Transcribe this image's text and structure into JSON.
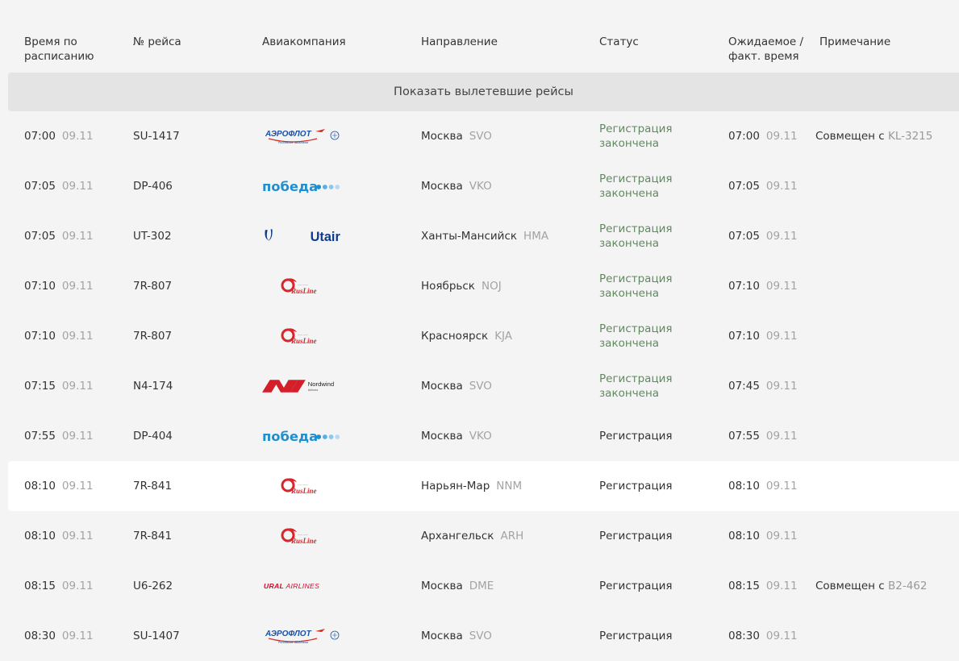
{
  "headers": {
    "time": [
      "Время по",
      "расписанию"
    ],
    "flight": "№ рейса",
    "airline": "Авиакомпания",
    "destination": "Направление",
    "status": "Статус",
    "expected": [
      "Ожидаемое /",
      "факт. время"
    ],
    "note": "Примечание"
  },
  "show_departed": "Показать вылетевшие рейсы",
  "rows": [
    {
      "time": "07:00",
      "date": "09.11",
      "flight": "SU-1417",
      "airline_logo": "aeroflot-logo",
      "city": "Москва",
      "code": "SVO",
      "status": [
        "Регистрация",
        "закончена"
      ],
      "status_done": true,
      "exp_time": "07:00",
      "exp_date": "09.11",
      "note_prefix": "Совмещен с ",
      "note_code": "KL-3215"
    },
    {
      "time": "07:05",
      "date": "09.11",
      "flight": "DP-406",
      "airline_logo": "pobeda-logo",
      "city": "Москва",
      "code": "VKO",
      "status": [
        "Регистрация",
        "закончена"
      ],
      "status_done": true,
      "exp_time": "07:05",
      "exp_date": "09.11",
      "note_prefix": "",
      "note_code": ""
    },
    {
      "time": "07:05",
      "date": "09.11",
      "flight": "UT-302",
      "airline_logo": "utair-logo",
      "city": "Ханты-Мансийск",
      "code": "HMA",
      "status": [
        "Регистрация",
        "закончена"
      ],
      "status_done": true,
      "exp_time": "07:05",
      "exp_date": "09.11",
      "note_prefix": "",
      "note_code": ""
    },
    {
      "time": "07:10",
      "date": "09.11",
      "flight": "7R-807",
      "airline_logo": "rusline-logo",
      "city": "Ноябрьск",
      "code": "NOJ",
      "status": [
        "Регистрация",
        "закончена"
      ],
      "status_done": true,
      "exp_time": "07:10",
      "exp_date": "09.11",
      "note_prefix": "",
      "note_code": ""
    },
    {
      "time": "07:10",
      "date": "09.11",
      "flight": "7R-807",
      "airline_logo": "rusline-logo",
      "city": "Красноярск",
      "code": "KJA",
      "status": [
        "Регистрация",
        "закончена"
      ],
      "status_done": true,
      "exp_time": "07:10",
      "exp_date": "09.11",
      "note_prefix": "",
      "note_code": ""
    },
    {
      "time": "07:15",
      "date": "09.11",
      "flight": "N4-174",
      "airline_logo": "nordwind-logo",
      "city": "Москва",
      "code": "SVO",
      "status": [
        "Регистрация",
        "закончена"
      ],
      "status_done": true,
      "exp_time": "07:45",
      "exp_date": "09.11",
      "note_prefix": "",
      "note_code": ""
    },
    {
      "time": "07:55",
      "date": "09.11",
      "flight": "DP-404",
      "airline_logo": "pobeda-logo",
      "city": "Москва",
      "code": "VKO",
      "status": [
        "Регистрация"
      ],
      "status_done": false,
      "exp_time": "07:55",
      "exp_date": "09.11",
      "note_prefix": "",
      "note_code": ""
    },
    {
      "time": "08:10",
      "date": "09.11",
      "flight": "7R-841",
      "airline_logo": "rusline-logo",
      "city": "Нарьян-Мар",
      "code": "NNM",
      "status": [
        "Регистрация"
      ],
      "status_done": false,
      "exp_time": "08:10",
      "exp_date": "09.11",
      "note_prefix": "",
      "note_code": "",
      "highlight": true
    },
    {
      "time": "08:10",
      "date": "09.11",
      "flight": "7R-841",
      "airline_logo": "rusline-logo",
      "city": "Архангельск",
      "code": "ARH",
      "status": [
        "Регистрация"
      ],
      "status_done": false,
      "exp_time": "08:10",
      "exp_date": "09.11",
      "note_prefix": "",
      "note_code": ""
    },
    {
      "time": "08:15",
      "date": "09.11",
      "flight": "U6-262",
      "airline_logo": "uralairlines-logo",
      "city": "Москва",
      "code": "DME",
      "status": [
        "Регистрация"
      ],
      "status_done": false,
      "exp_time": "08:15",
      "exp_date": "09.11",
      "note_prefix": "Совмещен с ",
      "note_code": "B2-462"
    },
    {
      "time": "08:30",
      "date": "09.11",
      "flight": "SU-1407",
      "airline_logo": "aeroflot-logo",
      "city": "Москва",
      "code": "SVO",
      "status": [
        "Регистрация"
      ],
      "status_done": false,
      "exp_time": "08:30",
      "exp_date": "09.11",
      "note_prefix": "",
      "note_code": ""
    }
  ],
  "logo_text": {
    "aeroflot": "АЭРОФЛОТ",
    "aeroflot_sub": "Российские авиалинии",
    "pobeda": "победа",
    "utair": "Utair",
    "rusline": "RusLine",
    "nordwind": "Nordwind",
    "nordwind_sub": "Airlines",
    "ural": "URAL AIRLINES"
  },
  "colors": {
    "status_done": "#5f8a5f",
    "aeroflot_blue": "#1c4fa1",
    "aeroflot_red": "#d52b1e",
    "pobeda_blue": "#1f8fd0",
    "utair_blue": "#0d3b8c",
    "rusline_red": "#d7262c",
    "nordwind_red": "#d41f2a",
    "ural_red": "#c8102e"
  }
}
